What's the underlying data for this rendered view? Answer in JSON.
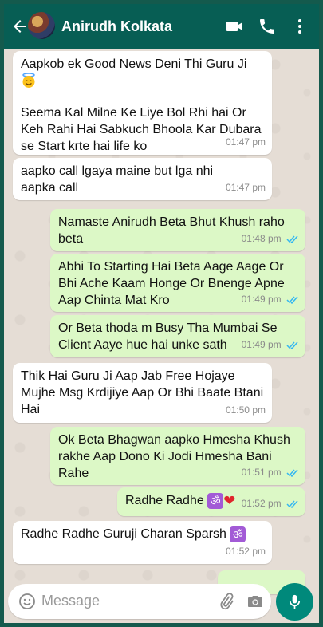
{
  "header": {
    "contact_name": "Anirudh Kolkata",
    "icons": [
      "back-arrow-icon",
      "avatar",
      "video-call-icon",
      "phone-call-icon",
      "more-vert-icon"
    ]
  },
  "messages": [
    {
      "direction": "in",
      "text": "Aapkob ek Good News Deni Thi Guru Ji",
      "emoji": "smiling-face-with-halo",
      "text2": "Seema Kal Milne Ke Liye Bol Rhi hai Or Keh Rahi Hai Sabkuch Bhoola Kar Dubara se Start krte hai life ko",
      "time": "01:47 pm"
    },
    {
      "direction": "in",
      "text": "aapko call lgaya maine but lga nhi aapka call",
      "time": "01:47 pm"
    },
    {
      "direction": "out",
      "text": "Namaste Anirudh Beta Bhut Khush raho beta",
      "time": "01:48 pm",
      "status": "read"
    },
    {
      "direction": "out",
      "text": "Abhi To Starting Hai Beta Aage Aage Or Bhi Ache Kaam Honge Or Bnenge Apne Aap Chinta Mat Kro",
      "time": "01:49 pm",
      "status": "read"
    },
    {
      "direction": "out",
      "text": "Or Beta thoda m Busy Tha Mumbai Se Client Aaye hue hai unke sath",
      "time": "01:49 pm",
      "status": "read"
    },
    {
      "direction": "in",
      "text": "Thik Hai Guru Ji Aap Jab Free Hojaye Mujhe Msg Krdijiye Aap Or Bhi Baate Btani Hai",
      "time": "01:50 pm"
    },
    {
      "direction": "out",
      "text": "Ok Beta Bhagwan aapko Hmesha Khush rakhe Aap Dono Ki Jodi Hmesha Bani Rahe",
      "time": "01:51 pm",
      "status": "read"
    },
    {
      "direction": "out",
      "text": "Radhe Radhe",
      "emoji": "om-symbol, red-heart",
      "time": "01:52 pm",
      "status": "read"
    },
    {
      "direction": "in",
      "text": "Radhe Radhe Guruji Charan Sparsh",
      "emoji": "om-symbol",
      "time": "01:52 pm"
    }
  ],
  "composer": {
    "placeholder": "Message",
    "icons": [
      "emoji-icon",
      "attach-icon",
      "camera-icon",
      "mic-icon"
    ]
  },
  "colors": {
    "header": "#075e54",
    "outgoing_bubble": "#dcf8c6",
    "incoming_bubble": "#ffffff",
    "read_tick": "#34b7f1",
    "mic_button": "#00897b"
  }
}
